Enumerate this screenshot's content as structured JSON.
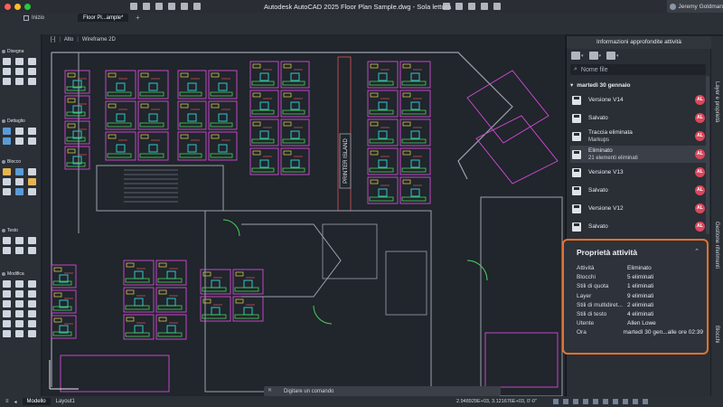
{
  "window": {
    "title": "Autodesk AutoCAD 2025   Floor Plan Sample.dwg - Sola lettura",
    "user": "Jeremy Goldman",
    "traffic_colors": [
      "#ff5f57",
      "#febc2e",
      "#28c840"
    ]
  },
  "tabs": {
    "start": "Inizio",
    "file": "Floor Pl...ample*",
    "add": "+"
  },
  "view_controls": {
    "view": "Alto",
    "style": "Wireframe 2D",
    "menu": "[-]"
  },
  "left_toolbar": {
    "sections": [
      "Disegna",
      "Dettaglio",
      "Blocco",
      "Testo",
      "Modifica"
    ]
  },
  "drawing": {
    "printer_label": "PRINTER ISLAND"
  },
  "command_line": {
    "placeholder": "Digitare un comando"
  },
  "status": {
    "model_tab": "Modello",
    "layout_tab": "Layout1",
    "coords": "2.948929E+03, 3.121676E+03, 0'-0\""
  },
  "panel": {
    "title": "Informazioni approfondite attività",
    "search_placeholder": "Nome file",
    "date": "martedì 30 gennaio",
    "activities": [
      {
        "title": "Versione V14",
        "sub": "",
        "avatar": "AL"
      },
      {
        "title": "Salvato",
        "sub": "",
        "avatar": "AL"
      },
      {
        "title": "Traccia eliminata",
        "sub": "Markups",
        "avatar": "AL"
      },
      {
        "title": "Eliminato",
        "sub": "21 elementi eliminati",
        "avatar": "AL"
      },
      {
        "title": "Versione V13",
        "sub": "",
        "avatar": "AL"
      },
      {
        "title": "Salvato",
        "sub": "",
        "avatar": "AL"
      },
      {
        "title": "Versione V12",
        "sub": "",
        "avatar": "AL"
      },
      {
        "title": "Salvato",
        "sub": "",
        "avatar": "AL"
      }
    ],
    "avatar_color": "#d9475c"
  },
  "properties": {
    "title": "Proprietà attività",
    "rows": [
      {
        "label": "Attività",
        "value": "Eliminato"
      },
      {
        "label": "Blocchi",
        "value": "5 eliminati"
      },
      {
        "label": "Stili di quota",
        "value": "1 eliminati"
      },
      {
        "label": "Layer",
        "value": "9 eliminati"
      },
      {
        "label": "Stili di multidiret...",
        "value": "2 eliminati"
      },
      {
        "label": "Stili di testo",
        "value": "4 eliminati"
      },
      {
        "label": "Utente",
        "value": "Allen Lowe"
      },
      {
        "label": "Ora",
        "value": "martedì 30 gen...alle ore 02:39"
      }
    ],
    "border_color": "#e8722a"
  },
  "side_tabs": [
    "Layer e proprietà",
    "Gestione riferimenti",
    "Blocchi"
  ]
}
